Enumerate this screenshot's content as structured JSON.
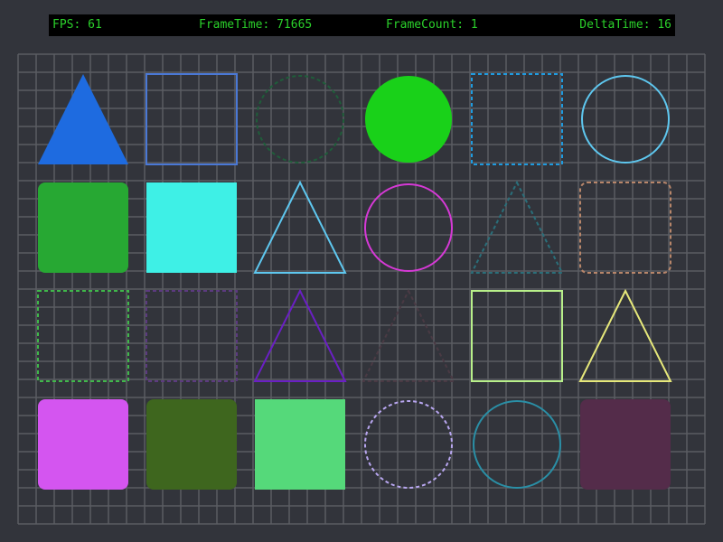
{
  "hud": {
    "fps_text": "FPS: 61",
    "frametime_text": "FrameTime: 71665",
    "framecount_text": "FrameCount: 1",
    "deltatime_text": "DeltaTime: 16",
    "text_color": "#2bd12b",
    "background": "#000000"
  },
  "canvas": {
    "background": "#32343b",
    "grid_color": "#5a5c63",
    "grid_columns": 38,
    "grid_rows": 26
  },
  "shapes": [
    {
      "type": "triangle",
      "style": "filled",
      "color": "#1e6be0"
    },
    {
      "type": "square",
      "style": "outline",
      "color": "#4a78d6"
    },
    {
      "type": "circle",
      "style": "dashed",
      "color": "#1f5e3a"
    },
    {
      "type": "circle",
      "style": "filled",
      "color": "#19d119"
    },
    {
      "type": "square",
      "style": "dashed",
      "color": "#1e9be0"
    },
    {
      "type": "circle",
      "style": "outline",
      "color": "#5ec7ef"
    },
    {
      "type": "rounded-square",
      "style": "filled",
      "color": "#27a833"
    },
    {
      "type": "square",
      "style": "filled",
      "color": "#3ef0e6"
    },
    {
      "type": "triangle",
      "style": "outline",
      "color": "#5ec7ef"
    },
    {
      "type": "circle",
      "style": "outline",
      "color": "#d639d6"
    },
    {
      "type": "triangle",
      "style": "dashed",
      "color": "#2a6f7a"
    },
    {
      "type": "rounded-square",
      "style": "dashed",
      "color": "#b8866a"
    },
    {
      "type": "square",
      "style": "dashed",
      "color": "#3fb84a"
    },
    {
      "type": "square",
      "style": "dashed",
      "color": "#5c3a80"
    },
    {
      "type": "triangle",
      "style": "outline",
      "color": "#6a1fc4"
    },
    {
      "type": "triangle",
      "style": "dashed",
      "color": "#4a3a44"
    },
    {
      "type": "square",
      "style": "outline",
      "color": "#b8f08a"
    },
    {
      "type": "triangle",
      "style": "outline",
      "color": "#e6e87a"
    },
    {
      "type": "rounded-square",
      "style": "filled",
      "color": "#d455f0"
    },
    {
      "type": "rounded-square",
      "style": "filled",
      "color": "#3e661e"
    },
    {
      "type": "square",
      "style": "filled",
      "color": "#55d97a"
    },
    {
      "type": "circle",
      "style": "dashed",
      "color": "#b8a6f0"
    },
    {
      "type": "circle",
      "style": "outline",
      "color": "#2a8fa6"
    },
    {
      "type": "rounded-square",
      "style": "filled",
      "color": "#542c4a"
    }
  ]
}
